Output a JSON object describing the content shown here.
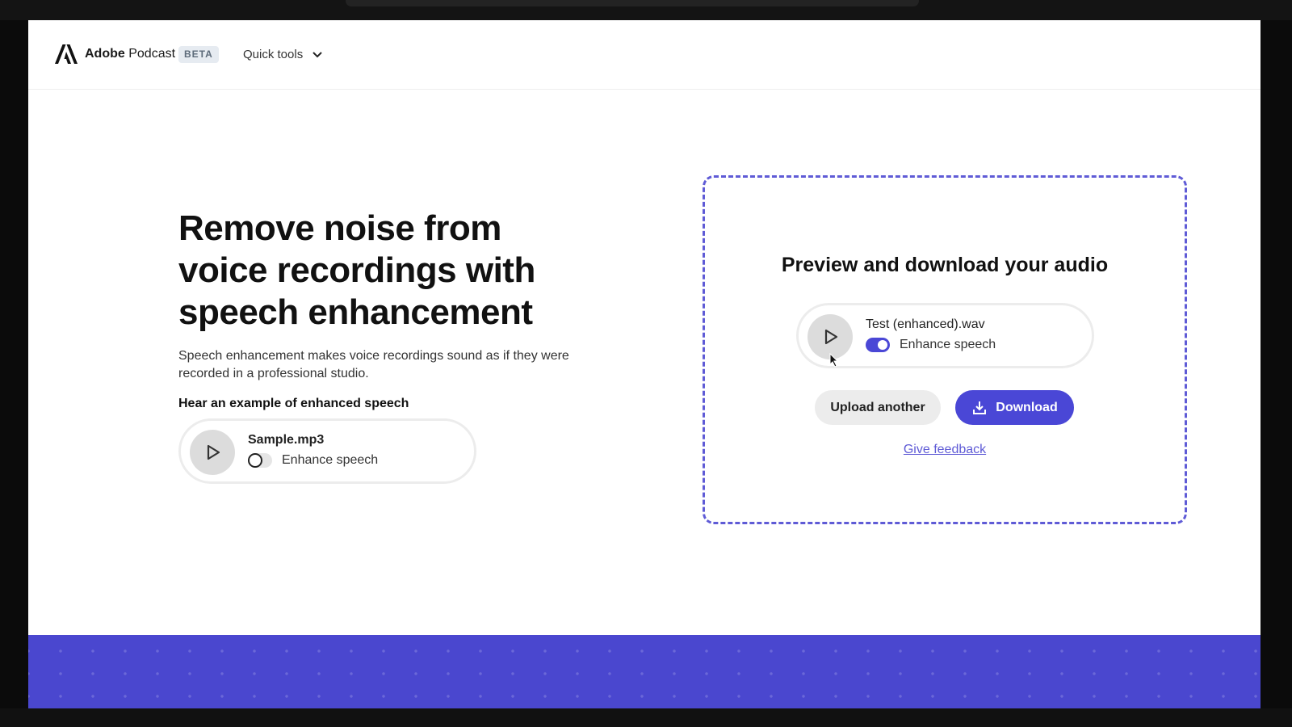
{
  "nav": {
    "brand_bold": "Adobe",
    "brand_light": "Podcast",
    "badge": "BETA",
    "quick_tools": "Quick tools"
  },
  "hero": {
    "title": "Remove noise from voice recordings with speech enhancement",
    "description": "Speech enhancement makes voice recordings sound as if they were recorded in a professional studio.",
    "example_heading": "Hear an example of enhanced speech"
  },
  "sample_player": {
    "filename": "Sample.mp3",
    "toggle_label": "Enhance speech",
    "toggle_on": false
  },
  "result_panel": {
    "title": "Preview and download your audio",
    "player": {
      "filename": "Test (enhanced).wav",
      "toggle_label": "Enhance speech",
      "toggle_on": true
    },
    "upload_button": "Upload another",
    "download_button": "Download",
    "feedback_link": "Give feedback"
  },
  "colors": {
    "accent": "#4a47d6",
    "dashed_border": "#5f5bd6",
    "footer": "#4a47cf"
  }
}
